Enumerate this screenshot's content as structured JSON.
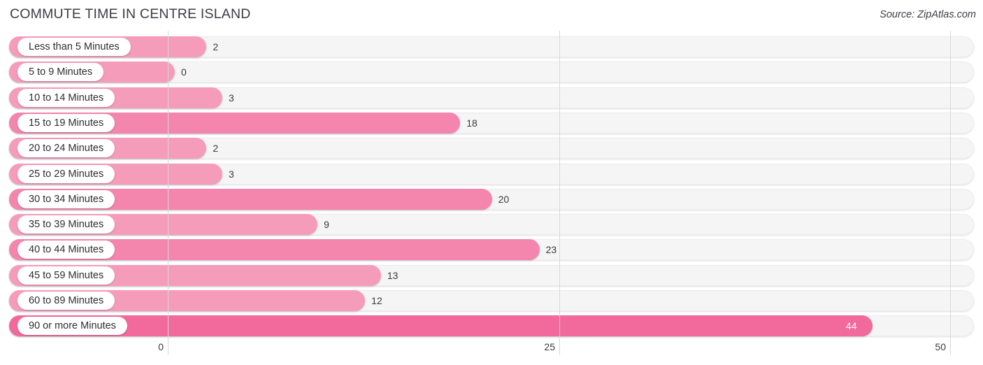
{
  "header": {
    "title": "COMMUTE TIME IN CENTRE ISLAND",
    "source": "Source: ZipAtlas.com"
  },
  "chart_data": {
    "type": "bar",
    "orientation": "horizontal",
    "title": "COMMUTE TIME IN CENTRE ISLAND",
    "xlabel": "",
    "ylabel": "",
    "xlim": [
      0,
      50
    ],
    "xticks": [
      "0",
      "25",
      "50"
    ],
    "xtick_values": [
      0,
      25,
      50
    ],
    "grid": true,
    "legend": "none",
    "categories": [
      "Less than 5 Minutes",
      "5 to 9 Minutes",
      "10 to 14 Minutes",
      "15 to 19 Minutes",
      "20 to 24 Minutes",
      "25 to 29 Minutes",
      "30 to 34 Minutes",
      "35 to 39 Minutes",
      "40 to 44 Minutes",
      "45 to 59 Minutes",
      "60 to 89 Minutes",
      "90 or more Minutes"
    ],
    "values": [
      2,
      0,
      3,
      18,
      2,
      3,
      20,
      9,
      23,
      13,
      12,
      44
    ],
    "value_labels": [
      "2",
      "0",
      "3",
      "18",
      "2",
      "3",
      "20",
      "9",
      "23",
      "13",
      "12",
      "44"
    ],
    "bar_shades": [
      "light",
      "light",
      "light",
      "mid",
      "light",
      "light",
      "mid",
      "light",
      "mid",
      "light",
      "light",
      "strong"
    ],
    "label_inside": [
      false,
      false,
      false,
      false,
      false,
      false,
      false,
      false,
      false,
      false,
      false,
      true
    ],
    "colors": {
      "bar_light": "#f69cbb",
      "bar_mid": "#f485ad",
      "bar_strong": "#f2699c",
      "track": "#f5f5f5",
      "gridline": "#d8d8d8",
      "text": "#3a3a3f"
    }
  }
}
